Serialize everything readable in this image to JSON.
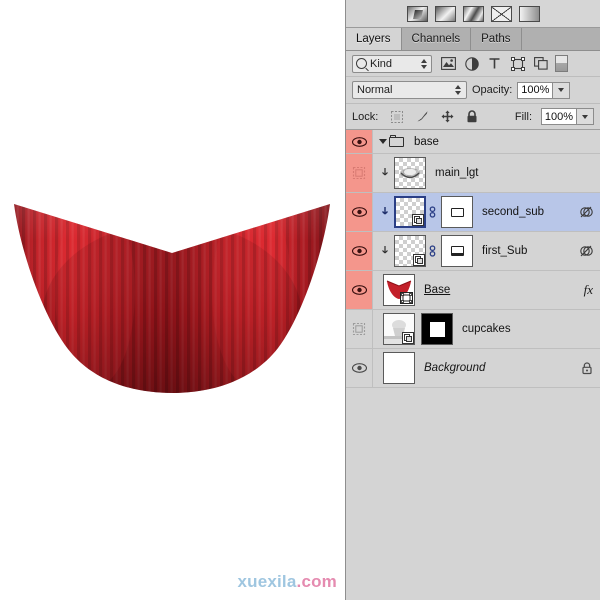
{
  "app": {
    "name": "Adobe Photoshop Layers Panel"
  },
  "presets": {
    "label": "gradient-presets",
    "items": [
      {
        "name": "preset-1"
      },
      {
        "name": "preset-2"
      },
      {
        "name": "preset-3"
      },
      {
        "name": "preset-4"
      },
      {
        "name": "preset-5"
      }
    ]
  },
  "tabs": [
    {
      "label": "Layers",
      "active": true
    },
    {
      "label": "Channels",
      "active": false
    },
    {
      "label": "Paths",
      "active": false
    }
  ],
  "filter_bar": {
    "kind_label": "Kind",
    "icons": [
      "pixel-filter-icon",
      "adjustment-filter-icon",
      "type-filter-icon",
      "shape-filter-icon",
      "smart-object-filter-icon"
    ],
    "toggle_name": "filter-enable-toggle"
  },
  "blend_bar": {
    "mode": "Normal",
    "opacity_label": "Opacity:",
    "opacity_value": "100%"
  },
  "lock_bar": {
    "lock_label": "Lock:",
    "icons": [
      "lock-transparent-pixels-icon",
      "lock-image-pixels-icon",
      "lock-position-icon",
      "lock-all-icon"
    ],
    "fill_label": "Fill:",
    "fill_value": "100%"
  },
  "layers": [
    {
      "name": "base",
      "type": "group",
      "visible": true,
      "selected": false,
      "eye_highlight": true,
      "expanded": true
    },
    {
      "name": "main_lgt",
      "type": "smart-object",
      "visible": false,
      "selected": false,
      "eye_highlight": true,
      "clipped": true,
      "has_mask": false,
      "right_icon": ""
    },
    {
      "name": "second_sub",
      "type": "smart-object",
      "visible": true,
      "selected": true,
      "eye_highlight": true,
      "clipped": true,
      "has_mask": true,
      "linked": true,
      "right_icon": "clipping-mask-icon"
    },
    {
      "name": "first_Sub",
      "type": "smart-object",
      "visible": true,
      "selected": false,
      "eye_highlight": true,
      "clipped": true,
      "has_mask": true,
      "linked": true,
      "right_icon": "clipping-mask-icon"
    },
    {
      "name": "Base",
      "type": "shape",
      "visible": true,
      "selected": false,
      "eye_highlight": true,
      "clipped": false,
      "has_mask": false,
      "underlined": true,
      "right_icon": "fx"
    },
    {
      "name": "cupcakes",
      "type": "smart-object",
      "visible": false,
      "selected": false,
      "eye_highlight": false,
      "clipped": false,
      "has_mask": true,
      "mask_style": "black",
      "right_icon": ""
    },
    {
      "name": "Background",
      "type": "background",
      "visible": true,
      "selected": false,
      "eye_highlight": false,
      "italic": true,
      "right_icon": "lock-icon"
    }
  ],
  "canvas": {
    "subject": "red cupcake wrapper",
    "colors": {
      "light": "#e8262c",
      "mid": "#c41f26",
      "dark": "#8e1118",
      "shadow": "#6d0d14",
      "background": "#ffffff"
    }
  },
  "watermark": {
    "text_primary": "xuexila",
    "text_secondary": ".com",
    "color_primary": "#9fc6e0",
    "color_secondary": "#e58bb0"
  }
}
